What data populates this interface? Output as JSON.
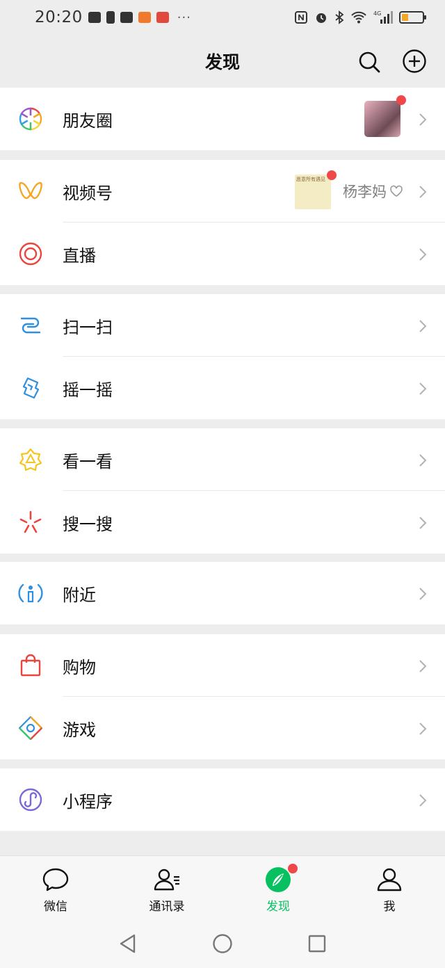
{
  "status_bar": {
    "time": "20:20",
    "more": "···",
    "network": "4G"
  },
  "header": {
    "title": "发现"
  },
  "menu": {
    "moments": {
      "label": "朋友圈"
    },
    "channels": {
      "label": "视频号",
      "author": "杨李妈",
      "thumb_text": "愿意所有遇见"
    },
    "live": {
      "label": "直播"
    },
    "scan": {
      "label": "扫一扫"
    },
    "shake": {
      "label": "摇一摇"
    },
    "top_stories": {
      "label": "看一看"
    },
    "search": {
      "label": "搜一搜"
    },
    "nearby": {
      "label": "附近"
    },
    "shopping": {
      "label": "购物"
    },
    "games": {
      "label": "游戏"
    },
    "mini_programs": {
      "label": "小程序"
    }
  },
  "bottom_nav": {
    "items": [
      {
        "label": "微信",
        "icon": "chat-icon"
      },
      {
        "label": "通讯录",
        "icon": "contacts-icon"
      },
      {
        "label": "发现",
        "icon": "discover-icon",
        "active": true
      },
      {
        "label": "我",
        "icon": "me-icon"
      }
    ]
  },
  "colors": {
    "accent": "#07c160",
    "badge": "#f04848",
    "background": "#ededed"
  }
}
